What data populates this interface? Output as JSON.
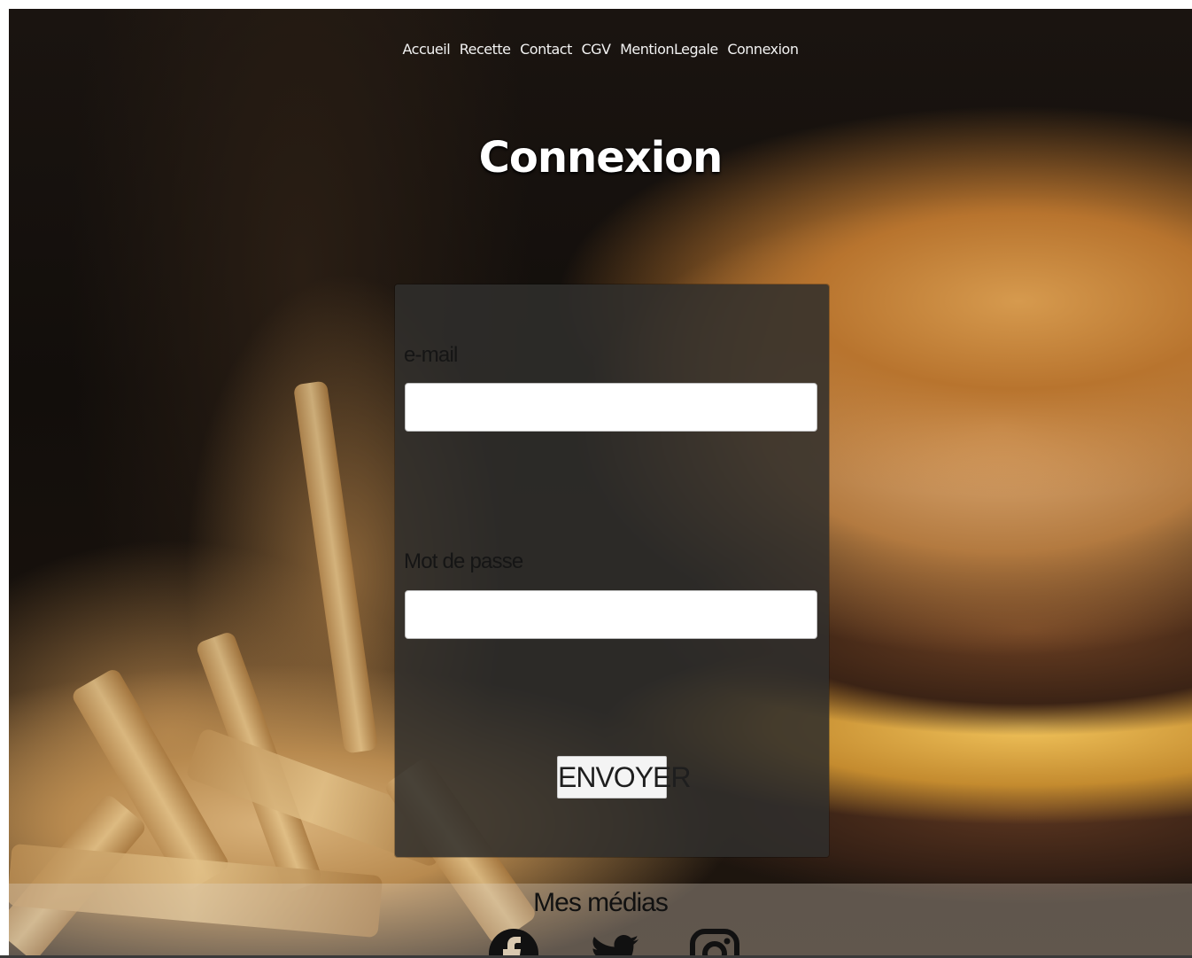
{
  "nav": {
    "items": [
      {
        "label": "Accueil"
      },
      {
        "label": "Recette"
      },
      {
        "label": "Contact"
      },
      {
        "label": "CGV"
      },
      {
        "label": "MentionLegale"
      },
      {
        "label": "Connexion"
      }
    ]
  },
  "page": {
    "title": "Connexion"
  },
  "form": {
    "email_label": "e-mail",
    "email_value": "",
    "password_label": "Mot de passe",
    "password_value": "",
    "submit_label": "ENVOYER"
  },
  "footer": {
    "title": "Mes médias",
    "social": [
      {
        "icon": "facebook-icon"
      },
      {
        "icon": "twitter-icon"
      },
      {
        "icon": "instagram-icon"
      }
    ]
  },
  "colors": {
    "card_bg": "#302e2c",
    "text_light": "#ffffff",
    "text_dark": "#151515"
  }
}
